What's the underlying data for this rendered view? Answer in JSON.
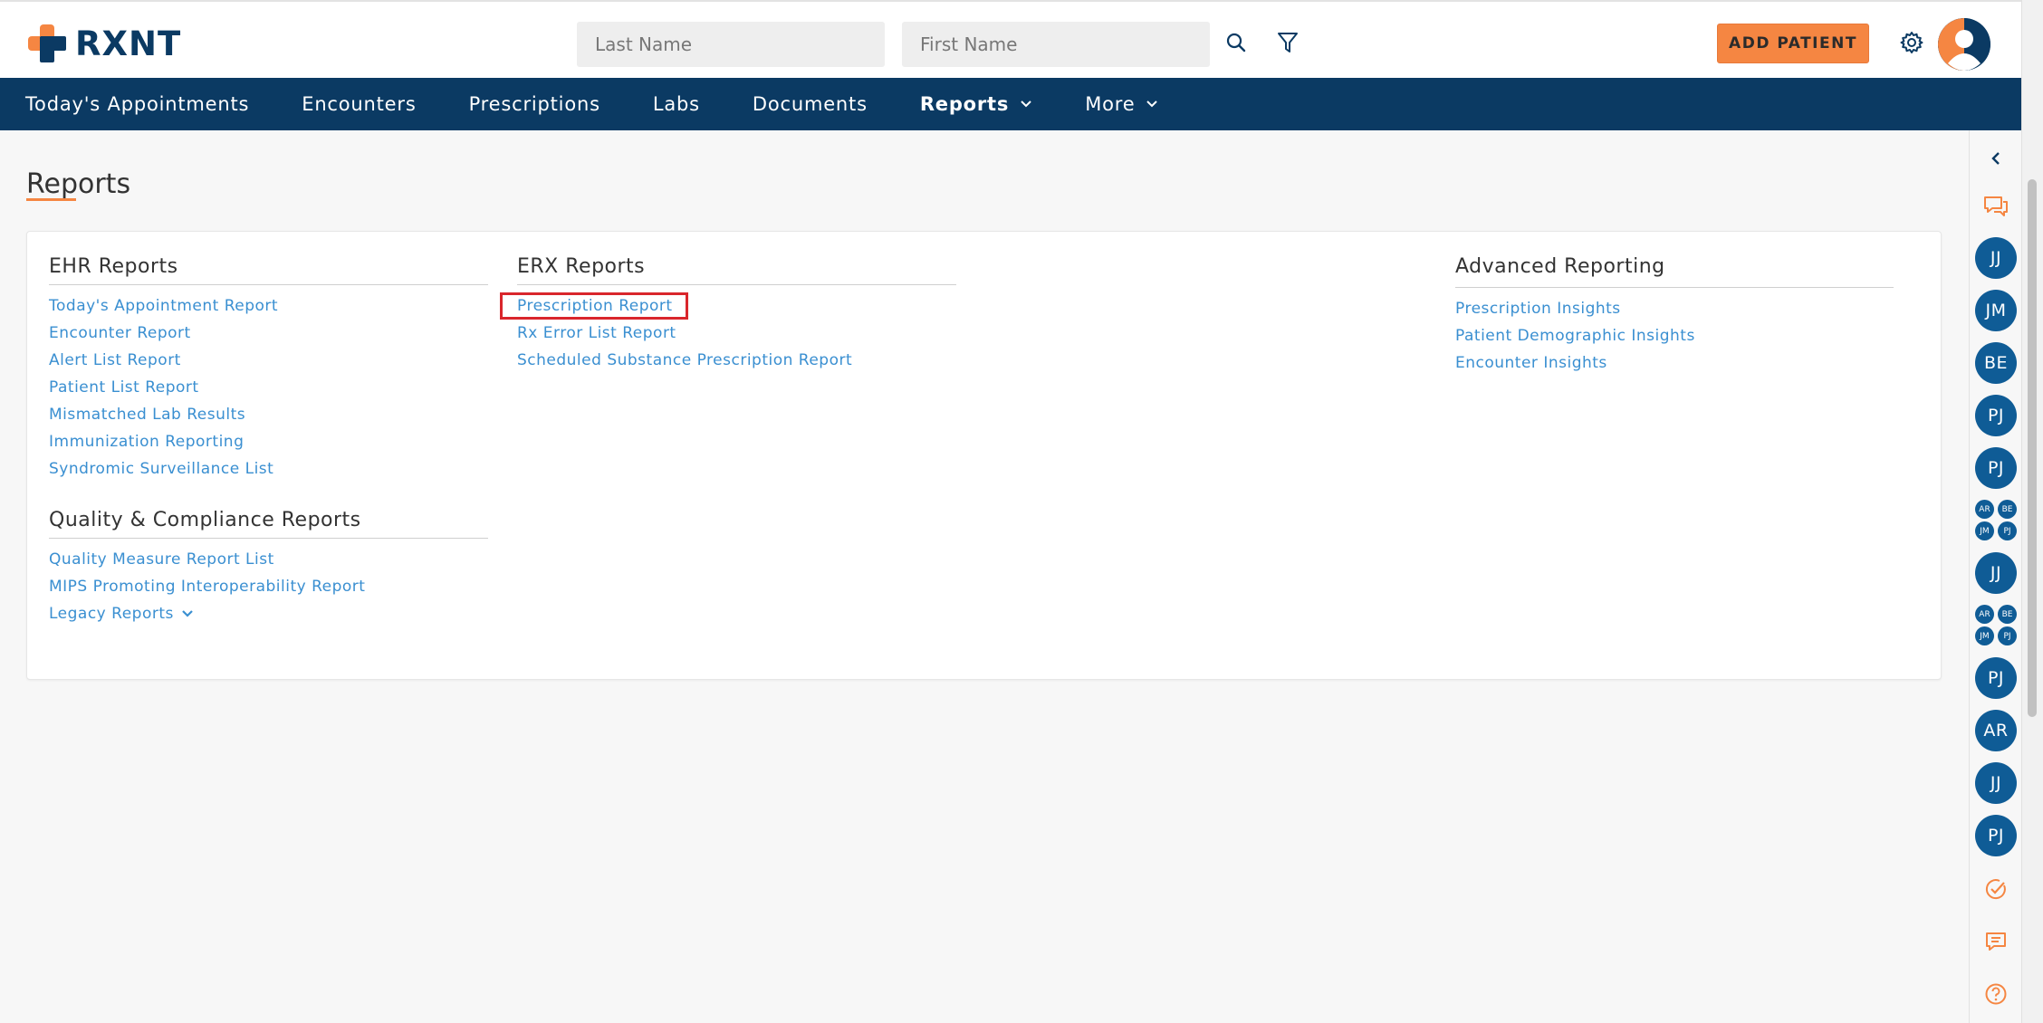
{
  "app": {
    "brand": "RXNT",
    "brand_color": "#0b3a63",
    "accent_color": "#f58642",
    "link_color": "#3a8fd1"
  },
  "header": {
    "last_name_placeholder": "Last Name",
    "first_name_placeholder": "First Name",
    "search_icon": "search-icon",
    "filter_icon": "filter-icon",
    "add_patient_label": "ADD PATIENT",
    "settings_icon": "gear-icon",
    "avatar_icon": "user-avatar-icon"
  },
  "nav": {
    "items": [
      {
        "label": "Today's Appointments"
      },
      {
        "label": "Encounters"
      },
      {
        "label": "Prescriptions"
      },
      {
        "label": "Labs"
      },
      {
        "label": "Documents"
      },
      {
        "label": "Reports"
      },
      {
        "label": "More"
      }
    ]
  },
  "page": {
    "title": "Reports"
  },
  "sections": {
    "ehr": {
      "heading": "EHR Reports",
      "links": [
        "Today's Appointment Report",
        "Encounter Report",
        "Alert List Report",
        "Patient List Report",
        "Mismatched Lab Results",
        "Immunization Reporting",
        "Syndromic Surveillance List"
      ]
    },
    "quality": {
      "heading": "Quality & Compliance Reports",
      "links": [
        "Quality Measure Report List",
        "MIPS Promoting Interoperability Report"
      ],
      "legacy_label": "Legacy Reports"
    },
    "erx": {
      "heading": "ERX Reports",
      "links": [
        "Prescription Report",
        "Rx Error List Report",
        "Scheduled Substance Prescription Report"
      ]
    },
    "advanced": {
      "heading": "Advanced Reporting",
      "links": [
        "Prescription Insights",
        "Patient Demographic Insights",
        "Encounter Insights"
      ]
    }
  },
  "rail": {
    "collapse_icon": "chevron-left-icon",
    "chat_icon": "chat-bubbles-icon",
    "avatars": [
      "JJ",
      "JM",
      "BE",
      "PJ",
      "PJ"
    ],
    "group1": [
      "AR",
      "BE",
      "JM",
      "PJ"
    ],
    "avatar_single": "JJ",
    "group2": [
      "AR",
      "BE",
      "JM",
      "PJ"
    ],
    "avatars2": [
      "PJ",
      "AR",
      "JJ",
      "PJ"
    ],
    "tasks_icon": "check-circle-icon",
    "messages_icon": "message-icon",
    "help_icon": "help-icon"
  }
}
